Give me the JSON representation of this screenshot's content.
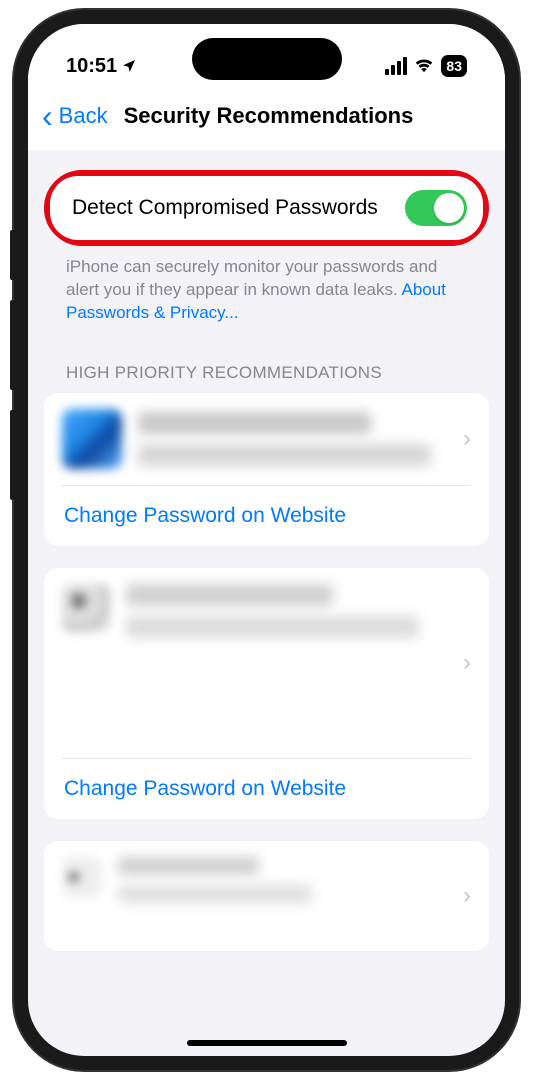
{
  "status": {
    "time": "10:51",
    "battery": "83"
  },
  "nav": {
    "back": "Back",
    "title": "Security Recommendations"
  },
  "toggle": {
    "label": "Detect Compromised Passwords",
    "on": true
  },
  "helper": {
    "text": "iPhone can securely monitor your passwords and alert you if they appear in known data leaks. ",
    "link": "About Passwords & Privacy..."
  },
  "section": {
    "header": "HIGH PRIORITY RECOMMENDATIONS"
  },
  "items": [
    {
      "action": "Change Password on Website"
    },
    {
      "action": "Change Password on Website"
    },
    {
      "action": ""
    }
  ]
}
